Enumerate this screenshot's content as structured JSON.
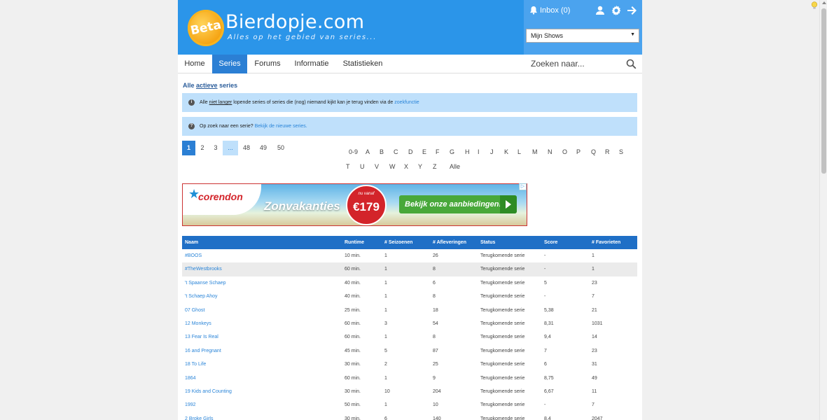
{
  "header": {
    "beta": "Beta",
    "site_name": "Bierdopje.com",
    "tagline": "Alles op het gebied van series...",
    "inbox": "Inbox (0)",
    "select_value": "Mijn Shows"
  },
  "nav": {
    "items": [
      "Home",
      "Series",
      "Forums",
      "Informatie",
      "Statistieken"
    ],
    "active": "Series",
    "search_placeholder": "Zoeken naar..."
  },
  "page": {
    "title_pre": "Alle",
    "title_link": "actieve",
    "title_post": "series",
    "info1_pre": "Alle",
    "info1_ul": "niet langer",
    "info1_mid": "lopende series of series die (nog) niemand kijkt kan je terug vinden via de",
    "info1_link": "zoekfunctie",
    "info2_pre": "Op zoek naar een serie?",
    "info2_link": "Bekijk de nieuwe series."
  },
  "pagination": [
    "1",
    "2",
    "3",
    "...",
    "48",
    "49",
    "50"
  ],
  "alphabet_row1": [
    "0-9",
    "A",
    "B",
    "C",
    "D",
    "E",
    "F",
    "G",
    "H",
    "I",
    "J",
    "K",
    "L",
    "M",
    "N",
    "O",
    "P",
    "Q",
    "R",
    "S"
  ],
  "alphabet_row2": [
    "T",
    "U",
    "V",
    "W",
    "X",
    "Y",
    "Z",
    "Alle"
  ],
  "ad": {
    "brand": "corendon",
    "headline": "Zonvakanties",
    "from": "nu vanaf",
    "price": "€179",
    "cta": "Bekijk onze aanbiedingen!"
  },
  "table": {
    "columns": [
      "Naam",
      "Runtime",
      "# Seizoenen",
      "# Afleveringen",
      "Status",
      "Score",
      "# Favorieten"
    ],
    "rows": [
      [
        "#BOOS",
        "10 min.",
        "1",
        "26",
        "Terugkomende serie",
        "-",
        "1"
      ],
      [
        "#TheWestbrooks",
        "60 min.",
        "1",
        "8",
        "Terugkomende serie",
        "-",
        "1"
      ],
      [
        "'t Spaanse Schaep",
        "40 min.",
        "1",
        "6",
        "Terugkomende serie",
        "5",
        "23"
      ],
      [
        "'t Schaep Ahoy",
        "40 min.",
        "1",
        "8",
        "Terugkomende serie",
        "-",
        "7"
      ],
      [
        "07 Ghost",
        "25 min.",
        "1",
        "18",
        "Terugkomende serie",
        "5,38",
        "21"
      ],
      [
        "12 Monkeys",
        "60 min.",
        "3",
        "54",
        "Terugkomende serie",
        "8,31",
        "1031"
      ],
      [
        "13 Fear Is Real",
        "60 min.",
        "1",
        "8",
        "Terugkomende serie",
        "9,4",
        "14"
      ],
      [
        "16 and Pregnant",
        "45 min.",
        "5",
        "87",
        "Terugkomende serie",
        "7",
        "23"
      ],
      [
        "18 To Life",
        "30 min.",
        "2",
        "25",
        "Terugkomende serie",
        "6",
        "31"
      ],
      [
        "1864",
        "60 min.",
        "1",
        "9",
        "Terugkomende serie",
        "8,75",
        "49"
      ],
      [
        "19 Kids and Counting",
        "30 min.",
        "10",
        "204",
        "Terugkomende serie",
        "6,67",
        "11"
      ],
      [
        "1992",
        "50 min.",
        "1",
        "10",
        "Terugkomende serie",
        "-",
        "7"
      ],
      [
        "2 Broke Girls",
        "30 min.",
        "6",
        "140",
        "Terugkomende serie",
        "8,4",
        "2047"
      ]
    ]
  }
}
